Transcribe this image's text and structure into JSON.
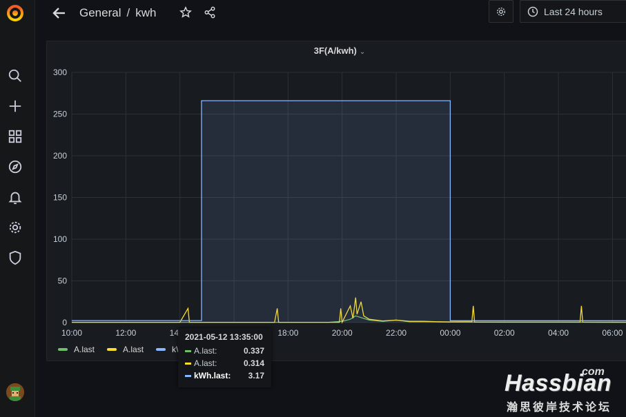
{
  "app": {
    "logo_icon": "grafana-logo-icon"
  },
  "sidebar": {
    "items": [
      {
        "name": "search",
        "icon": "search-icon"
      },
      {
        "name": "create",
        "icon": "plus-icon"
      },
      {
        "name": "dashboards",
        "icon": "apps-grid-icon"
      },
      {
        "name": "explore",
        "icon": "compass-icon"
      },
      {
        "name": "alerting",
        "icon": "bell-icon"
      },
      {
        "name": "configuration",
        "icon": "gear-icon"
      },
      {
        "name": "server-admin",
        "icon": "shield-icon"
      }
    ],
    "avatar_icon": "user-avatar"
  },
  "header": {
    "folder": "General",
    "separator": "/",
    "dashboard": "kwh",
    "time_range": "Last 24 hours"
  },
  "panel": {
    "title": "3F(A/kwh)",
    "title_caret": "⌄"
  },
  "chart_data": {
    "type": "line",
    "title": "3F(A/kwh)",
    "x_ticks": [
      "10:00",
      "12:00",
      "14:00",
      "16:00",
      "18:00",
      "20:00",
      "22:00",
      "00:00",
      "02:00",
      "04:00",
      "06:00"
    ],
    "y_ticks": [
      "0",
      "50",
      "100",
      "150",
      "200",
      "250",
      "300"
    ],
    "ylim": [
      0,
      300
    ],
    "xlim_hours": [
      10,
      30.5
    ],
    "grid": true,
    "legend_position": "bottom-left",
    "series": [
      {
        "name": "A.last",
        "color": "#73bf69",
        "points": [
          [
            10,
            0.3
          ],
          [
            14.5,
            0.3
          ],
          [
            16,
            0.3
          ],
          [
            18,
            0.3
          ],
          [
            19.5,
            0.3
          ],
          [
            20,
            1.5
          ],
          [
            20.3,
            4
          ],
          [
            20.5,
            8
          ],
          [
            20.7,
            6
          ],
          [
            21,
            3
          ],
          [
            21.5,
            1.5
          ],
          [
            22,
            3
          ],
          [
            22.5,
            1
          ],
          [
            23,
            1
          ],
          [
            23.5,
            0.8
          ],
          [
            24,
            0.5
          ],
          [
            26,
            0.4
          ],
          [
            28,
            0.4
          ],
          [
            30.5,
            0.3
          ]
        ]
      },
      {
        "name": "A.last",
        "color": "#fade2a",
        "points": [
          [
            10,
            0.3
          ],
          [
            14,
            0.3
          ],
          [
            14.3,
            17
          ],
          [
            14.35,
            0.3
          ],
          [
            17.5,
            0.3
          ],
          [
            17.6,
            17
          ],
          [
            17.65,
            0.3
          ],
          [
            19.9,
            0.3
          ],
          [
            19.95,
            17
          ],
          [
            20,
            0.3
          ],
          [
            20.3,
            20
          ],
          [
            20.4,
            5
          ],
          [
            20.5,
            30
          ],
          [
            20.55,
            10
          ],
          [
            20.7,
            25
          ],
          [
            20.8,
            8
          ],
          [
            21,
            4
          ],
          [
            21.5,
            2
          ],
          [
            22,
            3
          ],
          [
            22.5,
            1.5
          ],
          [
            23,
            1.5
          ],
          [
            23.5,
            1
          ],
          [
            24,
            0.8
          ],
          [
            24.8,
            1
          ],
          [
            24.85,
            20
          ],
          [
            24.9,
            0.5
          ],
          [
            28.8,
            0.5
          ],
          [
            28.85,
            20
          ],
          [
            28.9,
            0.5
          ],
          [
            30.5,
            0.4
          ]
        ]
      },
      {
        "name": "kWh.last",
        "color": "#8ab8ff",
        "points": [
          [
            10,
            2.4
          ],
          [
            14.8,
            2.4
          ],
          [
            14.8,
            266
          ],
          [
            24,
            266
          ],
          [
            24,
            2.2
          ],
          [
            30.5,
            2.2
          ]
        ]
      }
    ],
    "legend": [
      "A.last",
      "A.last",
      "kWh.last"
    ]
  },
  "tooltip": {
    "time": "2021-05-12 13:35:00",
    "rows": [
      {
        "label": "A.last:",
        "value": "0.337",
        "color": "#73bf69"
      },
      {
        "label": "A.last:",
        "value": "0.314",
        "color": "#fade2a"
      },
      {
        "label": "kWh.last:",
        "value": "3.17",
        "color": "#8ab8ff"
      }
    ]
  },
  "watermark": {
    "com": "com",
    "name": "Hassbian",
    "cn": "瀚思彼岸技术论坛"
  },
  "colors": {
    "background": "#111217",
    "panel": "#181b1f",
    "grid": "#2c3235",
    "accent_orange": "#f05a28"
  }
}
